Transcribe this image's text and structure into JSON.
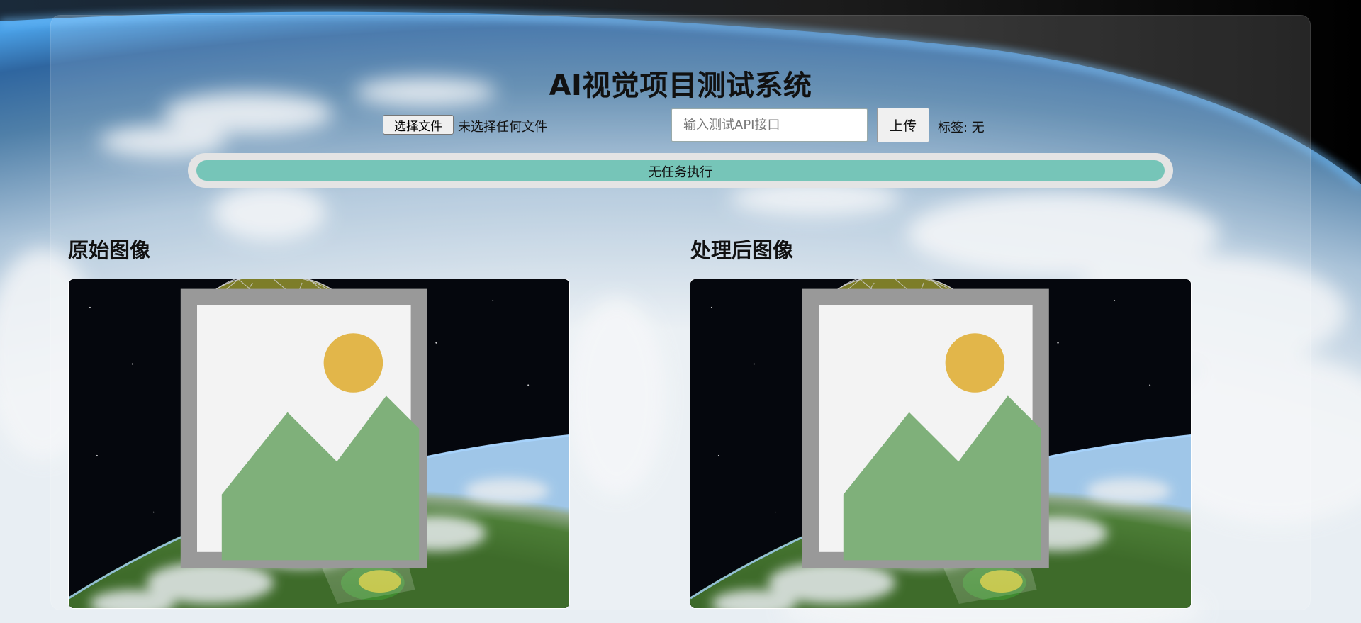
{
  "app": {
    "title": "AI视觉项目测试系统"
  },
  "upload_form": {
    "file_button_label": "选择文件",
    "file_status": "未选择任何文件",
    "api_placeholder": "输入测试API接口",
    "api_value": "",
    "upload_button_label": "上传",
    "tag_text": "标签: 无"
  },
  "progress": {
    "label": "无任务执行",
    "fraction": 1.0
  },
  "panels": {
    "original_title": "原始图像",
    "processed_title": "处理后图像"
  },
  "colors": {
    "progress_fill": "#76c5b8",
    "progress_track": "#e4e4e4"
  },
  "icons": {
    "broken_image": "broken-image-icon"
  }
}
